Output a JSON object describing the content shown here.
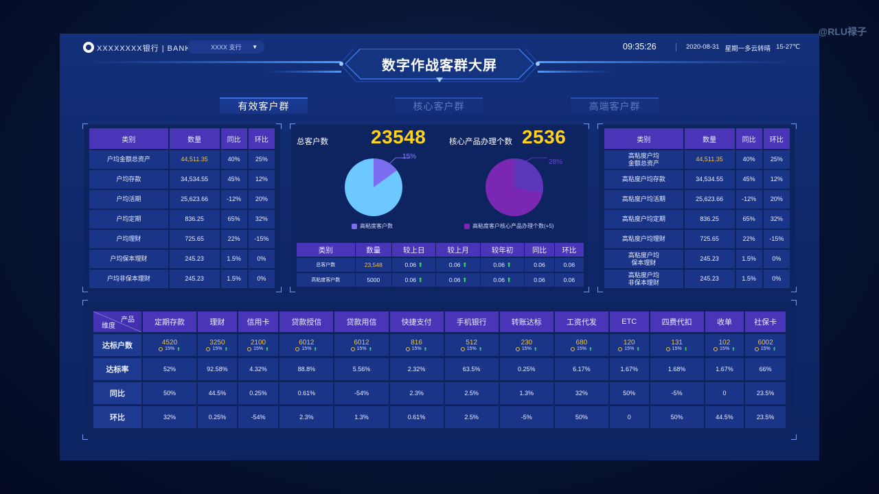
{
  "watermark": "@RLU禄子",
  "header": {
    "bank_name": "XXXXXXXX银行 | BANK",
    "branch": "XXXX 支行",
    "time": "09:35:26",
    "date": "2020-08-31",
    "weather": "星期一多云转晴",
    "temp": "15-27℃",
    "title": "数字作战客群大屏"
  },
  "tabs": [
    {
      "label": "有效客户群",
      "active": true
    },
    {
      "label": "核心客户群",
      "active": false
    },
    {
      "label": "高端客户群",
      "active": false
    }
  ],
  "left_table": {
    "headers": [
      "类别",
      "数量",
      "同比",
      "环比"
    ],
    "rows": [
      [
        "户均金额总资产",
        "44,511.35",
        "40%",
        "25%"
      ],
      [
        "户均存款",
        "34,534.55",
        "45%",
        "12%"
      ],
      [
        "户均活期",
        "25,623.66",
        "-12%",
        "20%"
      ],
      [
        "户均定期",
        "836.25",
        "65%",
        "32%"
      ],
      [
        "户均理财",
        "725.65",
        "22%",
        "-15%"
      ],
      [
        "户均保本理财",
        "245.23",
        "1.5%",
        "0%"
      ],
      [
        "户均非保本理财",
        "245.23",
        "1.5%",
        "0%"
      ]
    ]
  },
  "right_table": {
    "headers": [
      "类别",
      "数量",
      "同比",
      "环比"
    ],
    "rows": [
      [
        "高粘度户均\n金额总资产",
        "44,511.35",
        "40%",
        "25%"
      ],
      [
        "高粘度户均存款",
        "34,534.55",
        "45%",
        "12%"
      ],
      [
        "高粘度户均活期",
        "25,623.66",
        "-12%",
        "20%"
      ],
      [
        "高粘度户均定期",
        "836.25",
        "65%",
        "32%"
      ],
      [
        "高粘度户均理财",
        "725.65",
        "22%",
        "-15%"
      ],
      [
        "高粘度户均\n保本理财",
        "245.23",
        "1.5%",
        "0%"
      ],
      [
        "高粘度户均\n非保本理财",
        "245.23",
        "1.5%",
        "0%"
      ]
    ]
  },
  "middle": {
    "total_label": "总客户数",
    "total_value": "23548",
    "core_label": "核心产品办理个数",
    "core_value": "2536",
    "pie1_pct": "15%",
    "pie2_pct": "28%",
    "legend1": "高粘度客户数",
    "legend2": "高粘度客户核心产品办理个数(+5)",
    "colors": {
      "pie1_main": "#6cc8ff",
      "pie1_slice": "#7b6cf0",
      "pie2_main": "#7a27b3",
      "pie2_slice": "#5b37b9"
    },
    "table": {
      "headers": [
        "类别",
        "数量",
        "较上日",
        "较上月",
        "较年初",
        "同比",
        "环比"
      ],
      "rows": [
        [
          "总客户数",
          "23,548",
          "0.06",
          "0.06",
          "0.06",
          "0.06",
          "0.06"
        ],
        [
          "高粘度客户数",
          "5000",
          "0.06",
          "0.06",
          "0.06",
          "0.06",
          "0.06"
        ]
      ]
    }
  },
  "bottom": {
    "dim_top": "产品",
    "dim_bottom": "维度",
    "products": [
      "定期存款",
      "理财",
      "信用卡",
      "贷款授信",
      "贷款用信",
      "快捷支付",
      "手机银行",
      "转账达标",
      "工资代发",
      "ETC",
      "四费代扣",
      "收单",
      "社保卡"
    ],
    "row_labels": [
      "达标户数",
      "达标率",
      "同比",
      "环比"
    ],
    "counts": [
      "4520",
      "3250",
      "2100",
      "6012",
      "6012",
      "816",
      "512",
      "230",
      "680",
      "120",
      "131",
      "102",
      "6002"
    ],
    "count_sub": "15%",
    "rate": [
      "52%",
      "92.58%",
      "4.32%",
      "88.8%",
      "5.56%",
      "2.32%",
      "63.5%",
      "0.25%",
      "6.17%",
      "1.67%",
      "1.68%",
      "1.67%",
      "66%"
    ],
    "yoy": [
      "50%",
      "44.5%",
      "0.25%",
      "0.61%",
      "-54%",
      "2.3%",
      "2.5%",
      "1.3%",
      "32%",
      "50%",
      "-5%",
      "0",
      "23.5%"
    ],
    "mom": [
      "32%",
      "0.25%",
      "-54%",
      "2.3%",
      "1.3%",
      "0.61%",
      "2.5%",
      "-5%",
      "50%",
      "0",
      "50%",
      "44.5%",
      "23.5%"
    ]
  }
}
